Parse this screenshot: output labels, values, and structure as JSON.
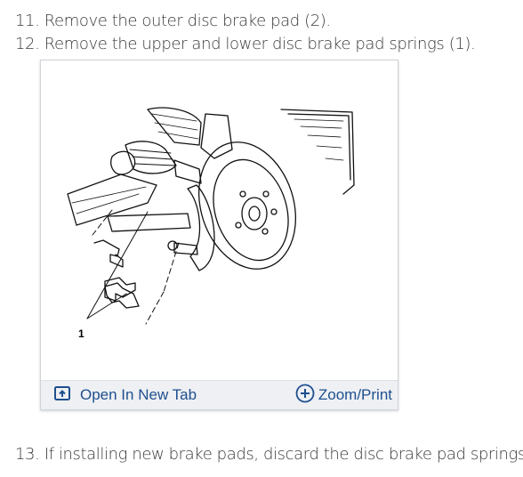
{
  "steps": {
    "s11": "11. Remove the outer disc brake pad (2).",
    "s12": "12. Remove the upper and lower disc brake pad springs (1).",
    "s13": "13. If installing new brake pads, discard the disc brake pad springs."
  },
  "figure": {
    "callout_1": "1",
    "open_tab_label": "Open In New Tab",
    "zoom_print_label": "Zoom/Print"
  },
  "colors": {
    "link": "#1f4f8f",
    "toolbar_bg": "#eef0f3"
  }
}
